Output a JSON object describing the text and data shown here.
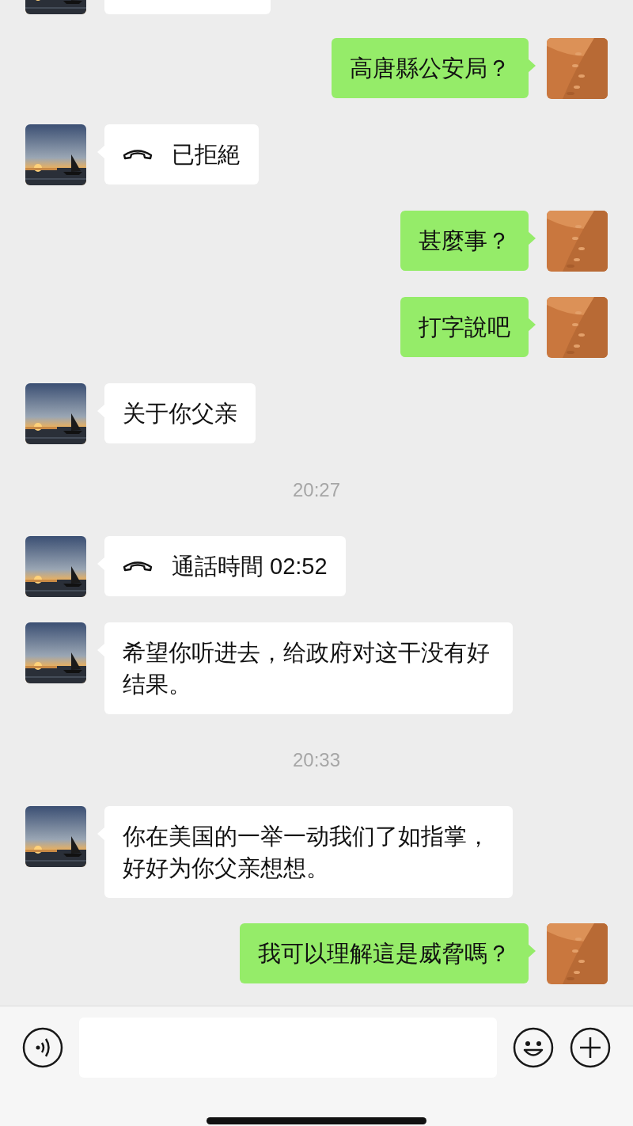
{
  "messages": [
    {
      "kind": "partial",
      "outgoing": false
    },
    {
      "kind": "text",
      "outgoing": true,
      "text": "高唐縣公安局？"
    },
    {
      "kind": "call",
      "outgoing": false,
      "text": "已拒絕"
    },
    {
      "kind": "text",
      "outgoing": true,
      "text": "甚麼事？"
    },
    {
      "kind": "text",
      "outgoing": true,
      "text": "打字說吧"
    },
    {
      "kind": "text",
      "outgoing": false,
      "text": "关于你父亲"
    },
    {
      "kind": "time",
      "text": "20:27"
    },
    {
      "kind": "call",
      "outgoing": false,
      "text": "通話時間 02:52"
    },
    {
      "kind": "text",
      "outgoing": false,
      "text": "希望你听进去，给政府对这干没有好结果。"
    },
    {
      "kind": "time",
      "text": "20:33"
    },
    {
      "kind": "text",
      "outgoing": false,
      "text": "你在美国的一举一动我们了如指掌，好好为你父亲想想。"
    },
    {
      "kind": "text",
      "outgoing": true,
      "text": "我可以理解這是威脅嗎？"
    }
  ]
}
